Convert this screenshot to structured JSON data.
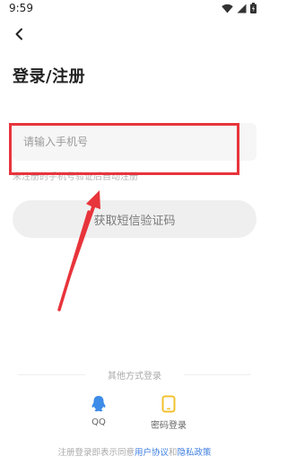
{
  "status_bar": {
    "time": "9:59"
  },
  "header": {
    "title": "登录/注册"
  },
  "phone": {
    "placeholder": "请输入手机号"
  },
  "hint": "未注册的手机号验证后自动注册",
  "code_button": "获取短信验证码",
  "other_methods": {
    "title": "其他方式登录",
    "items": [
      {
        "label": "QQ",
        "icon": "qq-icon",
        "color": "#3d8ce8"
      },
      {
        "label": "密码登录",
        "icon": "tablet-icon",
        "color": "#f2c230"
      }
    ]
  },
  "agreement": {
    "prefix": "注册登录即表示同意",
    "link1": "用户协议",
    "and": "和",
    "link2": "隐私政策"
  },
  "colors": {
    "annotation": "#e8343b",
    "link": "#3d7ee0"
  }
}
